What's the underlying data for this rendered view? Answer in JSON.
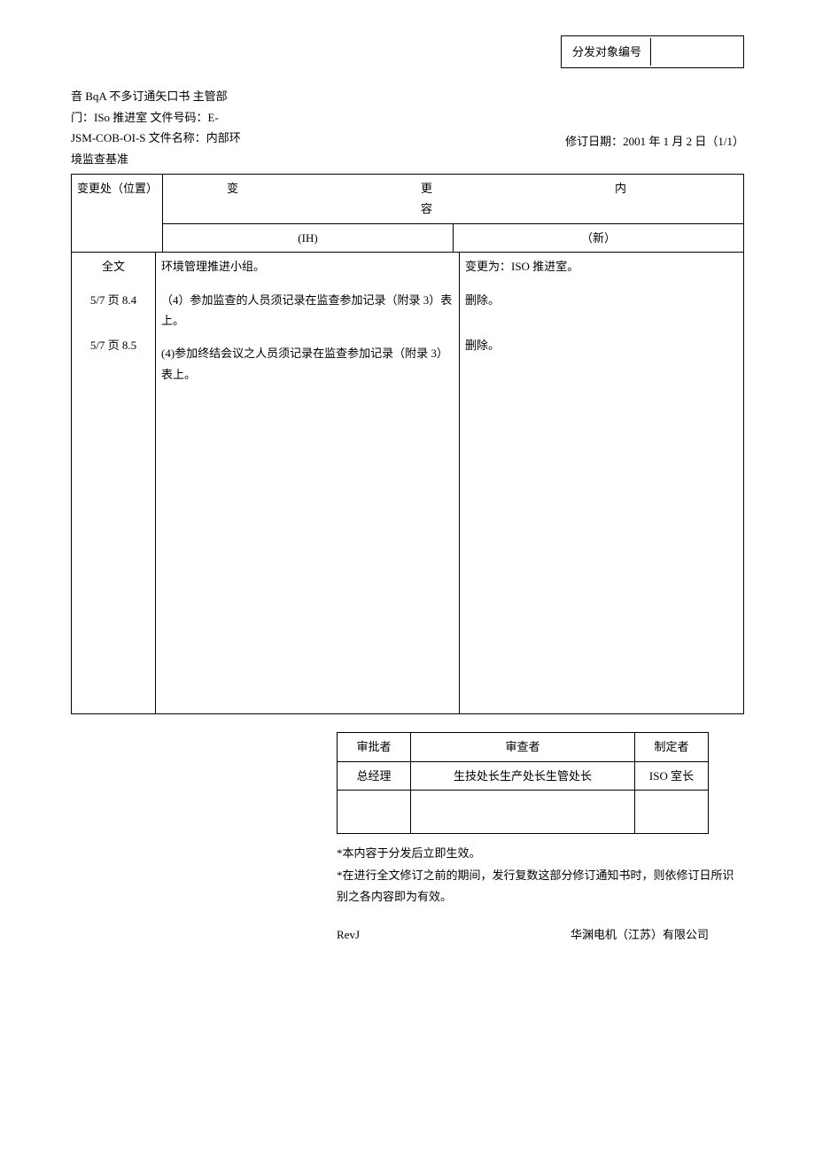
{
  "dist_label": "分发对象编号",
  "header": {
    "line1": "音 BqA 不多订通矢口书 主管部",
    "line2": "门：ISo 推进室 文件号码：E-",
    "line3": "JSM-COB-OI-S 文件名称：内部环",
    "line4": "境监查基准",
    "rev_date": "修订日期：2001 年 1 月 2 日（1/1）"
  },
  "table": {
    "loc_header": "变更处（位置）",
    "change_header": "变　　更　　内　　容",
    "old_header": "(IH)",
    "new_header": "（新）",
    "rows": [
      {
        "loc": "全文",
        "old": "环境管理推进小组。",
        "new": "变更为：ISO 推进室。"
      },
      {
        "loc": "5/7 页 8.4",
        "old": "（4）参加监查的人员须记录在监查参加记录（附录 3）表上。",
        "new": "删除。"
      },
      {
        "loc": "5/7 页 8.5",
        "old": "(4)参加终结会议之人员须记录在监查参加记录（附录 3）表上。",
        "new": "删除。"
      }
    ]
  },
  "approval": {
    "h1": "审批者",
    "h2": "审查者",
    "h3": "制定者",
    "v1": "总经理",
    "v2": "生技处长生产处长生管处长",
    "v3": "ISO 室长"
  },
  "notes": {
    "n1": "*本内容于分发后立即生效。",
    "n2": "*在进行全文修订之前的期间，发行复数这部分修订通知书时，则依修订日所识别之各内容即为有效。"
  },
  "footer": {
    "rev": "RevJ",
    "company": "华渊电机（江苏）有限公司"
  }
}
